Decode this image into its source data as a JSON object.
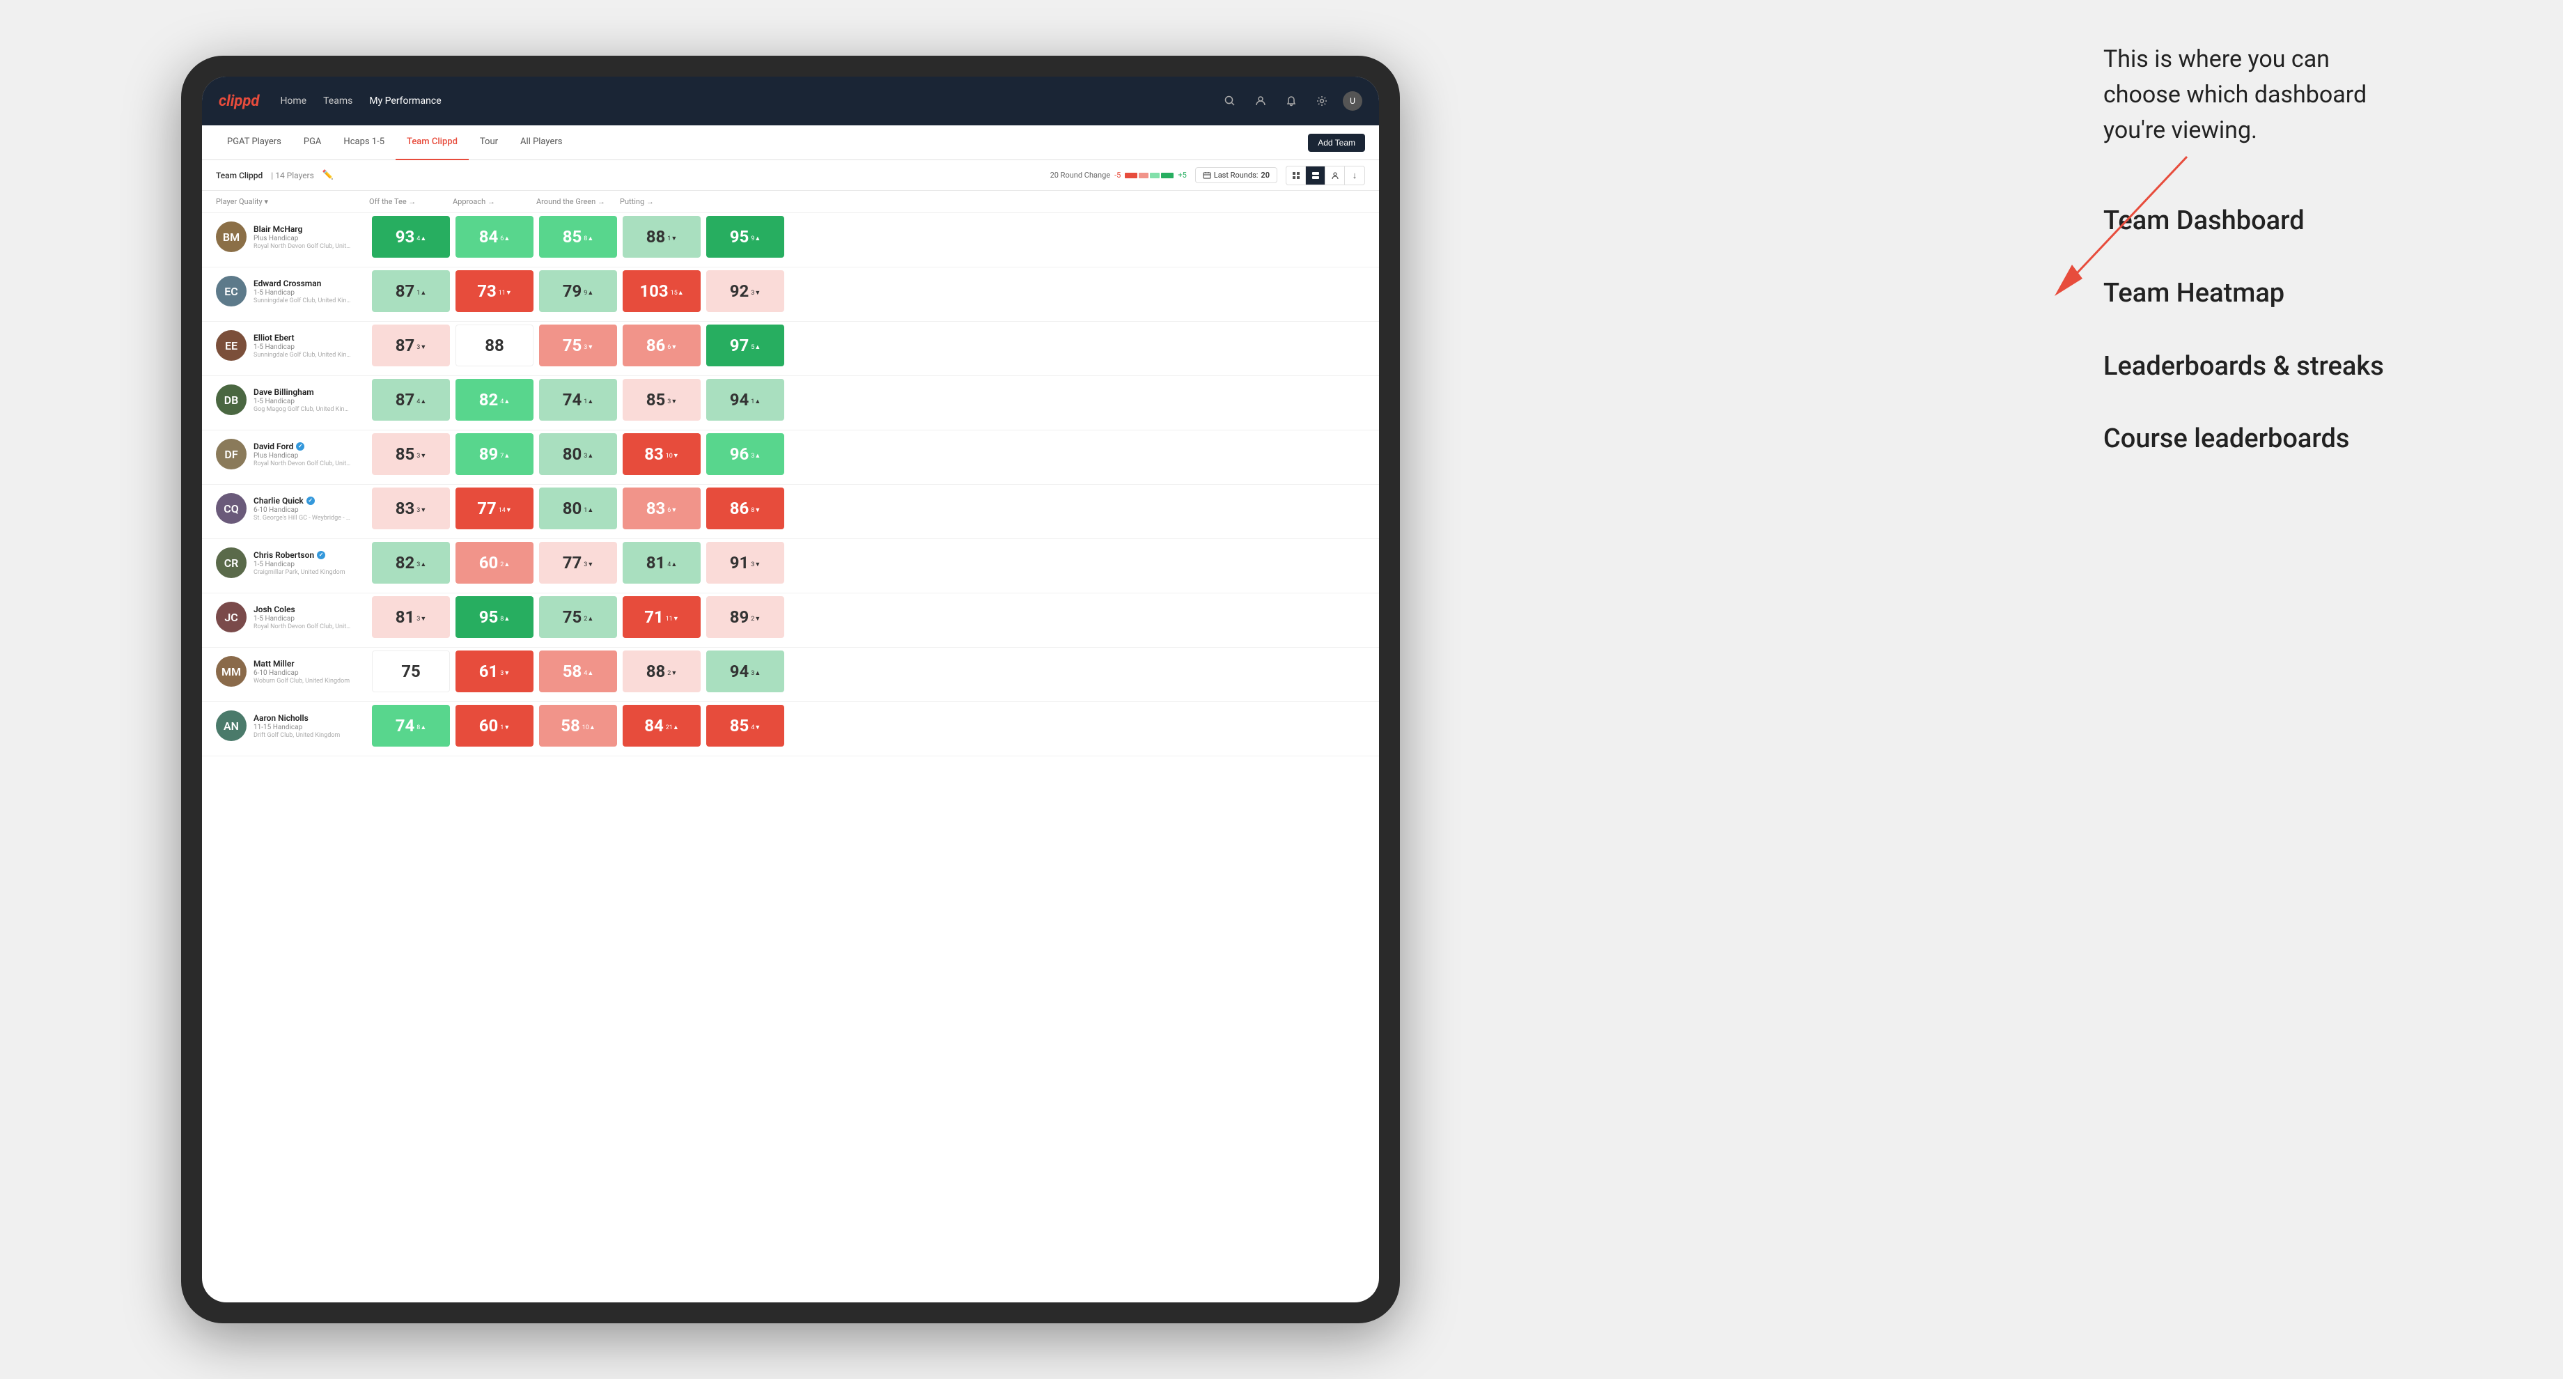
{
  "annotation": {
    "callout": "This is where you can\nchoose which dashboard\nyou're viewing.",
    "options": [
      "Team Dashboard",
      "Team Heatmap",
      "Leaderboards & streaks",
      "Course leaderboards"
    ]
  },
  "nav": {
    "logo": "clippd",
    "items": [
      "Home",
      "Teams",
      "My Performance"
    ],
    "active": "My Performance"
  },
  "sub_nav": {
    "tabs": [
      "PGAT Players",
      "PGA",
      "Hcaps 1-5",
      "Team Clippd",
      "Tour",
      "All Players"
    ],
    "active": "Team Clippd",
    "add_button": "Add Team"
  },
  "toolbar": {
    "team_label": "Team Clippd",
    "team_count": "14 Players",
    "round_change_label": "20 Round Change",
    "round_change_minus": "-5",
    "round_change_plus": "+5",
    "last_rounds_label": "Last Rounds:",
    "last_rounds_value": "20"
  },
  "col_headers": [
    {
      "label": "Player Quality",
      "sortable": true
    },
    {
      "label": "Off the Tee",
      "sortable": true
    },
    {
      "label": "Approach",
      "sortable": true
    },
    {
      "label": "Around the Green",
      "sortable": true
    },
    {
      "label": "Putting",
      "sortable": true
    }
  ],
  "players": [
    {
      "name": "Blair McHarg",
      "handicap": "Plus Handicap",
      "club": "Royal North Devon Golf Club, United Kingdom",
      "avatar_color": "#8B6F47",
      "initials": "BM",
      "scores": [
        {
          "value": 93,
          "change": 4,
          "dir": "up",
          "bg": "bg-green-dark"
        },
        {
          "value": 84,
          "change": 6,
          "dir": "up",
          "bg": "bg-green-mid"
        },
        {
          "value": 85,
          "change": 8,
          "dir": "up",
          "bg": "bg-green-mid"
        },
        {
          "value": 88,
          "change": 1,
          "dir": "down",
          "bg": "bg-green-light"
        },
        {
          "value": 95,
          "change": 9,
          "dir": "up",
          "bg": "bg-green-dark"
        }
      ]
    },
    {
      "name": "Edward Crossman",
      "handicap": "1-5 Handicap",
      "club": "Sunningdale Golf Club, United Kingdom",
      "avatar_color": "#5D7A8A",
      "initials": "EC",
      "scores": [
        {
          "value": 87,
          "change": 1,
          "dir": "up",
          "bg": "bg-green-light"
        },
        {
          "value": 73,
          "change": 11,
          "dir": "down",
          "bg": "bg-red-dark"
        },
        {
          "value": 79,
          "change": 9,
          "dir": "up",
          "bg": "bg-green-light"
        },
        {
          "value": 103,
          "change": 15,
          "dir": "up",
          "bg": "bg-red-dark"
        },
        {
          "value": 92,
          "change": 3,
          "dir": "down",
          "bg": "bg-red-light"
        }
      ]
    },
    {
      "name": "Elliot Ebert",
      "handicap": "1-5 Handicap",
      "club": "Sunningdale Golf Club, United Kingdom",
      "avatar_color": "#7B4F3A",
      "initials": "EE",
      "scores": [
        {
          "value": 87,
          "change": 3,
          "dir": "down",
          "bg": "bg-red-light"
        },
        {
          "value": 88,
          "change": 0,
          "dir": "",
          "bg": "bg-white"
        },
        {
          "value": 75,
          "change": 3,
          "dir": "down",
          "bg": "bg-red-mid"
        },
        {
          "value": 86,
          "change": 6,
          "dir": "down",
          "bg": "bg-red-mid"
        },
        {
          "value": 97,
          "change": 5,
          "dir": "up",
          "bg": "bg-green-dark"
        }
      ]
    },
    {
      "name": "Dave Billingham",
      "handicap": "1-5 Handicap",
      "club": "Gog Magog Golf Club, United Kingdom",
      "avatar_color": "#4A6741",
      "initials": "DB",
      "scores": [
        {
          "value": 87,
          "change": 4,
          "dir": "up",
          "bg": "bg-green-light"
        },
        {
          "value": 82,
          "change": 4,
          "dir": "up",
          "bg": "bg-green-mid"
        },
        {
          "value": 74,
          "change": 1,
          "dir": "up",
          "bg": "bg-green-light"
        },
        {
          "value": 85,
          "change": 3,
          "dir": "down",
          "bg": "bg-red-light"
        },
        {
          "value": 94,
          "change": 1,
          "dir": "up",
          "bg": "bg-green-light"
        }
      ]
    },
    {
      "name": "David Ford",
      "handicap": "Plus Handicap",
      "club": "Royal North Devon Golf Club, United Kingdom",
      "avatar_color": "#8A7A5A",
      "initials": "DF",
      "verified": true,
      "scores": [
        {
          "value": 85,
          "change": 3,
          "dir": "down",
          "bg": "bg-red-light"
        },
        {
          "value": 89,
          "change": 7,
          "dir": "up",
          "bg": "bg-green-mid"
        },
        {
          "value": 80,
          "change": 3,
          "dir": "up",
          "bg": "bg-green-light"
        },
        {
          "value": 83,
          "change": 10,
          "dir": "down",
          "bg": "bg-red-dark"
        },
        {
          "value": 96,
          "change": 3,
          "dir": "up",
          "bg": "bg-green-mid"
        }
      ]
    },
    {
      "name": "Charlie Quick",
      "handicap": "6-10 Handicap",
      "club": "St. George's Hill GC - Weybridge - Surrey, Uni...",
      "avatar_color": "#6A5A7A",
      "initials": "CQ",
      "verified": true,
      "scores": [
        {
          "value": 83,
          "change": 3,
          "dir": "down",
          "bg": "bg-red-light"
        },
        {
          "value": 77,
          "change": 14,
          "dir": "down",
          "bg": "bg-red-dark"
        },
        {
          "value": 80,
          "change": 1,
          "dir": "up",
          "bg": "bg-green-light"
        },
        {
          "value": 83,
          "change": 6,
          "dir": "down",
          "bg": "bg-red-mid"
        },
        {
          "value": 86,
          "change": 8,
          "dir": "down",
          "bg": "bg-red-dark"
        }
      ]
    },
    {
      "name": "Chris Robertson",
      "handicap": "1-5 Handicap",
      "club": "Craigmillar Park, United Kingdom",
      "avatar_color": "#5A6A4A",
      "initials": "CR",
      "verified": true,
      "scores": [
        {
          "value": 82,
          "change": 3,
          "dir": "up",
          "bg": "bg-green-light"
        },
        {
          "value": 60,
          "change": 2,
          "dir": "up",
          "bg": "bg-red-mid"
        },
        {
          "value": 77,
          "change": 3,
          "dir": "down",
          "bg": "bg-red-light"
        },
        {
          "value": 81,
          "change": 4,
          "dir": "up",
          "bg": "bg-green-light"
        },
        {
          "value": 91,
          "change": 3,
          "dir": "down",
          "bg": "bg-red-light"
        }
      ]
    },
    {
      "name": "Josh Coles",
      "handicap": "1-5 Handicap",
      "club": "Royal North Devon Golf Club, United Kingdom",
      "avatar_color": "#7A4A4A",
      "initials": "JC",
      "scores": [
        {
          "value": 81,
          "change": 3,
          "dir": "down",
          "bg": "bg-red-light"
        },
        {
          "value": 95,
          "change": 8,
          "dir": "up",
          "bg": "bg-green-dark"
        },
        {
          "value": 75,
          "change": 2,
          "dir": "up",
          "bg": "bg-green-light"
        },
        {
          "value": 71,
          "change": 11,
          "dir": "down",
          "bg": "bg-red-dark"
        },
        {
          "value": 89,
          "change": 2,
          "dir": "down",
          "bg": "bg-red-light"
        }
      ]
    },
    {
      "name": "Matt Miller",
      "handicap": "6-10 Handicap",
      "club": "Woburn Golf Club, United Kingdom",
      "avatar_color": "#8A6A4A",
      "initials": "MM",
      "scores": [
        {
          "value": 75,
          "change": 0,
          "dir": "",
          "bg": "bg-white"
        },
        {
          "value": 61,
          "change": 3,
          "dir": "down",
          "bg": "bg-red-dark"
        },
        {
          "value": 58,
          "change": 4,
          "dir": "up",
          "bg": "bg-red-mid"
        },
        {
          "value": 88,
          "change": 2,
          "dir": "down",
          "bg": "bg-red-light"
        },
        {
          "value": 94,
          "change": 3,
          "dir": "up",
          "bg": "bg-green-light"
        }
      ]
    },
    {
      "name": "Aaron Nicholls",
      "handicap": "11-15 Handicap",
      "club": "Drift Golf Club, United Kingdom",
      "avatar_color": "#4A7A6A",
      "initials": "AN",
      "scores": [
        {
          "value": 74,
          "change": 8,
          "dir": "up",
          "bg": "bg-green-mid"
        },
        {
          "value": 60,
          "change": 1,
          "dir": "down",
          "bg": "bg-red-dark"
        },
        {
          "value": 58,
          "change": 10,
          "dir": "up",
          "bg": "bg-red-mid"
        },
        {
          "value": 84,
          "change": 21,
          "dir": "up",
          "bg": "bg-red-dark"
        },
        {
          "value": 85,
          "change": 4,
          "dir": "down",
          "bg": "bg-red-dark"
        }
      ]
    }
  ]
}
